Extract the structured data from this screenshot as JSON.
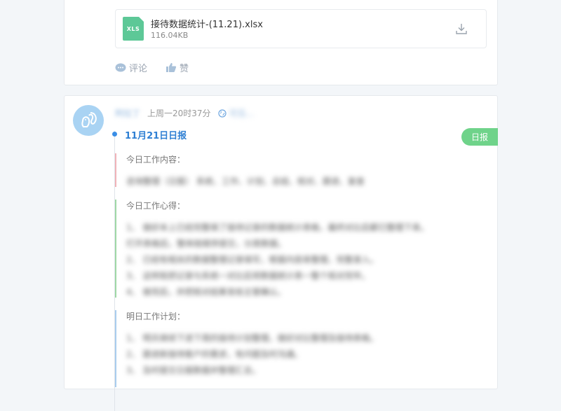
{
  "post1": {
    "attachment": {
      "type_label": "XLS",
      "name": "接待数据统计-(11.21).xlsx",
      "size": "116.04KB"
    },
    "actions": {
      "comment_label": "评论",
      "like_label": "赞"
    }
  },
  "post2": {
    "author": "阿拉丁",
    "time": "上周一20时37分",
    "scope": "可见...",
    "title": "11月21日日报",
    "badge": "日报",
    "sections": [
      {
        "label": "今日工作内容：",
        "lines": [
          "咨询整理（日报）  系统、工作、计划、总结、核对、跟进、复查"
        ]
      },
      {
        "label": "今日工作心得：",
        "lines": [
          "1、 做好本上已经完整填了接待记录的数据统计表格，最终对比后都已整理下来。",
          "打开表格后，整体按顺序提交，分类数据。",
          "2、 已经有相关的数据整理记录填写，根据内容来整理，完整录入。",
          "3、 这样既把记录与系统一对比后将数据统计表一整个核对完毕。",
          "4、 做完后，并把核对结果发给主管确认。"
        ]
      },
      {
        "label": "明日工作计划：",
        "lines": [
          "1、 明天继续下进下周的接待计划整理，做好对比整理及接待表格。",
          "2、 跟进新接待客户的需求，有问题及时沟通。",
          "3、 及时提交日报数据并整理汇总。"
        ]
      }
    ]
  }
}
